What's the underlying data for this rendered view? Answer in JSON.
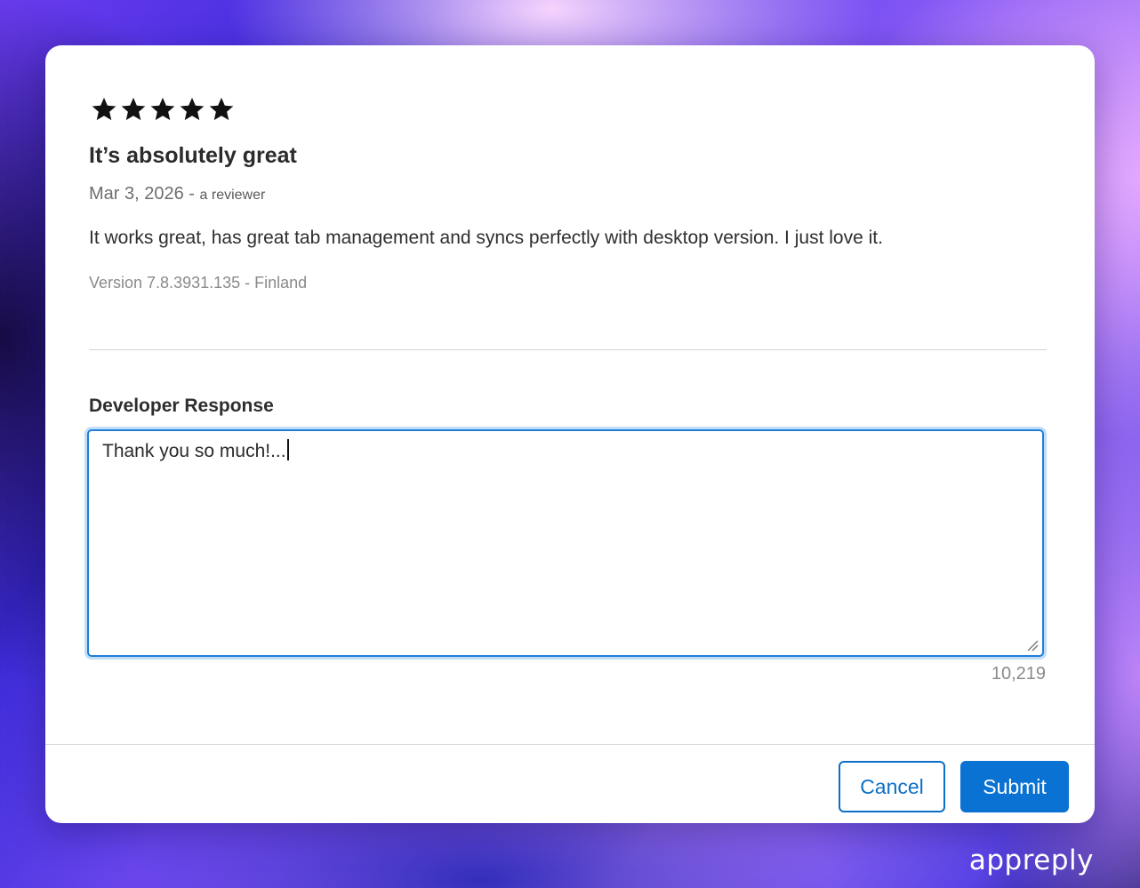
{
  "review": {
    "rating": 5,
    "rating_max": 5,
    "title": "It’s absolutely great",
    "date": "Mar 3, 2026",
    "separator": " - ",
    "reviewer": "a reviewer",
    "body": "It works great, has great tab management and syncs perfectly with desktop version. I just love it.",
    "version_info": "Version 7.8.3931.135 - Finland"
  },
  "response": {
    "label": "Developer Response",
    "value": "Thank you so much!...",
    "char_count": "10,219"
  },
  "buttons": {
    "cancel_label": "Cancel",
    "submit_label": "Submit"
  },
  "brand": {
    "name": "appreply"
  },
  "icons": {
    "star": "star-icon",
    "resize": "resize-handle-icon"
  },
  "colors": {
    "accent": "#0a72d2",
    "focus_ring": "#1f7fd6",
    "star": "#111111"
  }
}
